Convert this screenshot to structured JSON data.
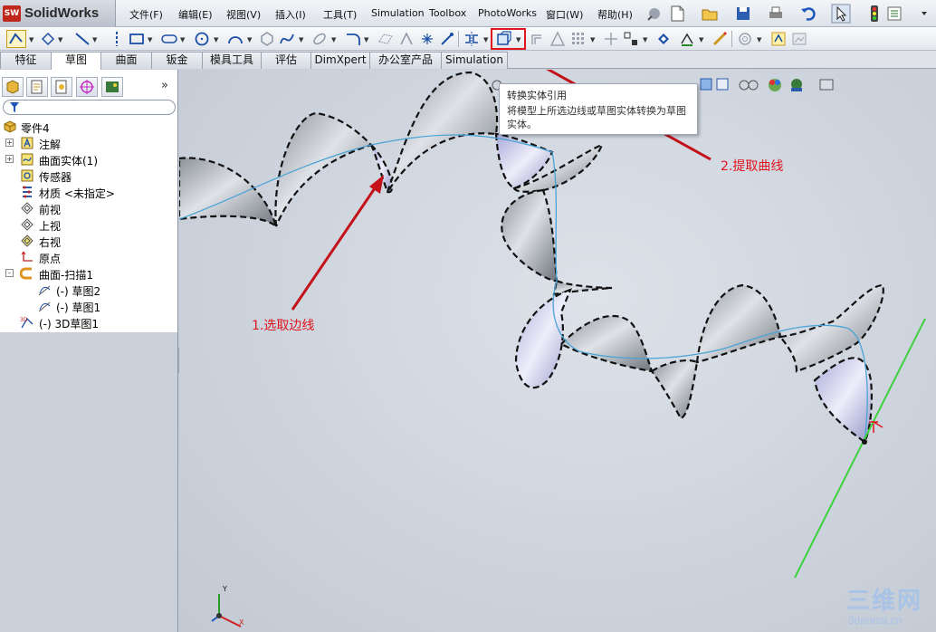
{
  "app": {
    "logo_badge": "SW",
    "name": "SolidWorks"
  },
  "menu": {
    "items": [
      {
        "label": "文件(F)"
      },
      {
        "label": "编辑(E)"
      },
      {
        "label": "视图(V)"
      },
      {
        "label": "插入(I)"
      },
      {
        "label": "工具(T)"
      },
      {
        "label": "Simulation"
      },
      {
        "label": "Toolbox"
      },
      {
        "label": "PhotoWorks"
      },
      {
        "label": "窗口(W)"
      },
      {
        "label": "帮助(H)"
      }
    ]
  },
  "tabs": [
    {
      "label": "特征",
      "active": false
    },
    {
      "label": "草图",
      "active": true
    },
    {
      "label": "曲面",
      "active": false
    },
    {
      "label": "钣金",
      "active": false
    },
    {
      "label": "模具工具",
      "active": false
    },
    {
      "label": "评估",
      "active": false
    },
    {
      "label": "DimXpert",
      "active": false
    },
    {
      "label": "办公室产品",
      "active": false
    },
    {
      "label": "Simulation",
      "active": false
    }
  ],
  "panel": {
    "collapse_glyph": "»",
    "tree": [
      {
        "label": "零件4",
        "icon": "part-icon",
        "level": 0,
        "expander": ""
      },
      {
        "label": "注解",
        "icon": "annotation-icon",
        "level": 1,
        "expander": "+"
      },
      {
        "label": "曲面实体(1)",
        "icon": "surface-body-icon",
        "level": 1,
        "expander": "+"
      },
      {
        "label": "传感器",
        "icon": "sensor-icon",
        "level": 1,
        "expander": ""
      },
      {
        "label": "材质 <未指定>",
        "icon": "material-icon",
        "level": 1,
        "expander": ""
      },
      {
        "label": "前视",
        "icon": "plane-icon",
        "level": 1,
        "expander": ""
      },
      {
        "label": "上视",
        "icon": "plane-icon",
        "level": 1,
        "expander": ""
      },
      {
        "label": "右视",
        "icon": "plane-icon",
        "level": 1,
        "expander": ""
      },
      {
        "label": "原点",
        "icon": "origin-icon",
        "level": 1,
        "expander": ""
      },
      {
        "label": "曲面-扫描1",
        "icon": "sweep-surface-icon",
        "level": 1,
        "expander": "-"
      },
      {
        "label": "(-) 草图2",
        "icon": "sketch-icon",
        "level": 2,
        "expander": ""
      },
      {
        "label": "(-) 草图1",
        "icon": "sketch-icon",
        "level": 2,
        "expander": ""
      },
      {
        "label": "(-) 3D草图1",
        "icon": "sketch-3d-icon",
        "level": 1,
        "expander": ""
      }
    ]
  },
  "tooltip": {
    "title": "转换实体引用",
    "description": "将模型上所选边线或草图实体转换为草图实体。"
  },
  "annotations": {
    "step1": "1.选取边线",
    "step2": "2.提取曲线"
  },
  "triad": {
    "y": "Y",
    "x": "X"
  },
  "watermark": {
    "line1": "三维网",
    "line2": "3dportal.cn"
  },
  "colors": {
    "annotation_red": "#e0141e",
    "highlight_box": "#e0141e",
    "helix_line": "#4aa3d6",
    "edge_green": "#3ed13e"
  }
}
